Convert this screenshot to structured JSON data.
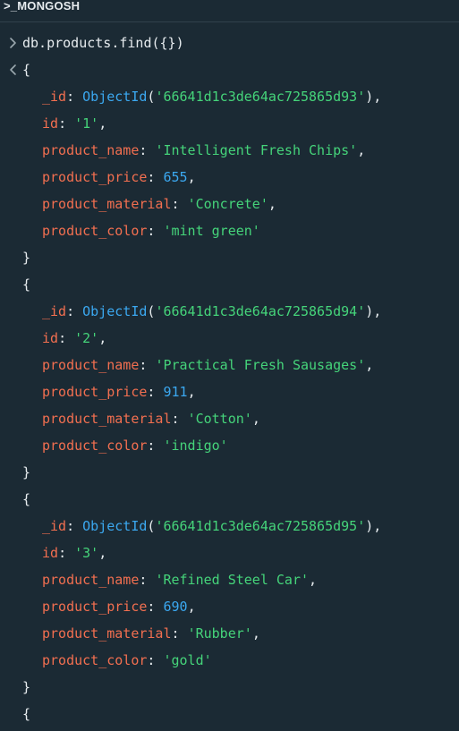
{
  "header": {
    "title": ">_MONGOSH"
  },
  "command": "db.products.find({})",
  "icons": {
    "input": "chevron-right-icon",
    "output": "chevron-left-icon"
  },
  "colors": {
    "background": "#1b2a34",
    "key": "#f26f50",
    "string": "#45d47a",
    "number": "#3ba8f0",
    "function": "#3ba8f0"
  },
  "punct": {
    "open_brace": "{",
    "close_brace": "}",
    "colon": ": ",
    "comma": ",",
    "oid_open": "(",
    "oid_close": ")"
  },
  "oid_label": "ObjectId",
  "documents": [
    {
      "_id": "'66641d1c3de64ac725865d93'",
      "id": "'1'",
      "product_name": "'Intelligent Fresh Chips'",
      "product_price": "655",
      "product_material": "'Concrete'",
      "product_color": "'mint green'"
    },
    {
      "_id": "'66641d1c3de64ac725865d94'",
      "id": "'2'",
      "product_name": "'Practical Fresh Sausages'",
      "product_price": "911",
      "product_material": "'Cotton'",
      "product_color": "'indigo'"
    },
    {
      "_id": "'66641d1c3de64ac725865d95'",
      "id": "'3'",
      "product_name": "'Refined Steel Car'",
      "product_price": "690",
      "product_material": "'Rubber'",
      "product_color": "'gold'"
    }
  ],
  "fields": {
    "_id": "_id",
    "id": "id",
    "product_name": "product_name",
    "product_price": "product_price",
    "product_material": "product_material",
    "product_color": "product_color"
  }
}
